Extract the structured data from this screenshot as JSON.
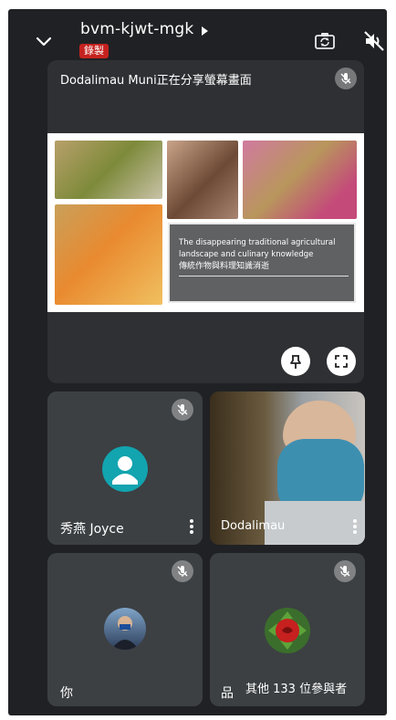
{
  "header": {
    "meeting_code": "bvm-kjwt-mgk",
    "recording_label": "錄製",
    "icons": [
      "chevron-down-icon",
      "chevron-right-icon",
      "switch-camera-icon",
      "speaker-off-icon"
    ]
  },
  "presentation": {
    "title": "Dodalimau Muni正在分享螢幕畫面",
    "slide_text_en": "The disappearing traditional agricultural landscape and culinary knowledge",
    "slide_text_zh": "傳統作物與料理知識消逝"
  },
  "participants": [
    {
      "name": "秀燕 Joyce",
      "muted": true
    },
    {
      "name": "Dodalimau",
      "muted": false
    },
    {
      "name": "你",
      "muted": true
    },
    {
      "name": "品",
      "muted": true
    }
  ],
  "others": {
    "label": "其他 133 位參與者"
  },
  "colors": {
    "background": "#202124",
    "tile": "#3c4043",
    "recording": "#c5221f",
    "avatar_teal": "#12a4af"
  }
}
